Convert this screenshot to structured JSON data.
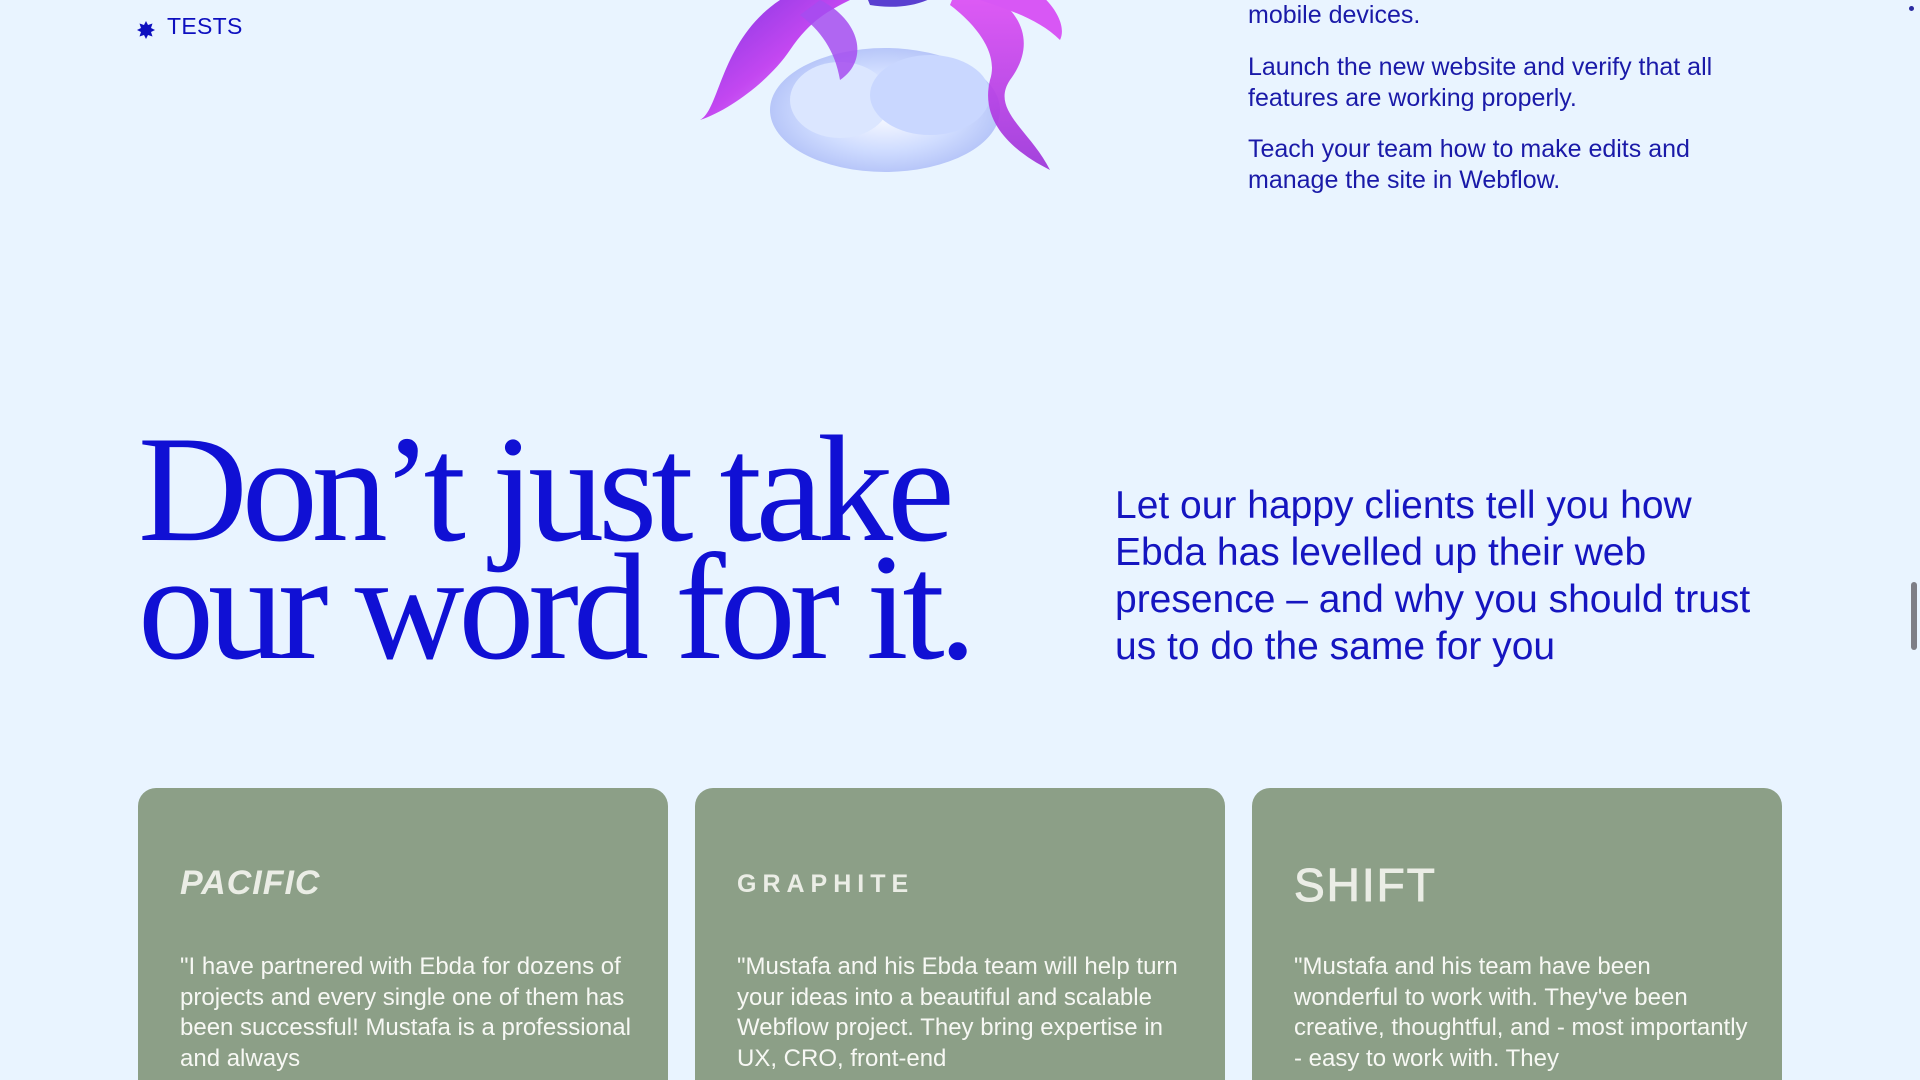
{
  "process": {
    "tag_label": "TESTS",
    "items": [
      {
        "text": "mobile devices."
      },
      {
        "text": "Launch the new website and verify that all features are working properly."
      },
      {
        "text": "Teach your team how to make edits and manage the site in Webflow."
      }
    ]
  },
  "testimonials": {
    "heading_line1": "Don’t just take",
    "heading_line2": "our word for it.",
    "intro": "Let our happy clients tell you how Ebda has levelled up their web presence – and why you should trust us to do the same for you",
    "cards": [
      {
        "brand": "PACIFIC",
        "quote": "\"I have partnered with Ebda for dozens of projects and every single one of them has been successful! Mustafa is a professional and always"
      },
      {
        "brand": "GRAPHITE",
        "quote": "\"Mustafa and his Ebda team will help turn your ideas into a beautiful and scalable Webflow project. They bring expertise in UX, CRO, front-end"
      },
      {
        "brand": "SHIFT",
        "quote": "\"Mustafa and his team have been wonderful to work with. They've been creative, thoughtful, and - most importantly - easy to work with. They"
      }
    ]
  },
  "colors": {
    "background": "#e9f4ff",
    "accent_blue": "#1010d4",
    "card_green": "#8c9f87"
  },
  "icons": {
    "tag_icon": "badge-star-icon",
    "art": "abstract-3d-art"
  }
}
